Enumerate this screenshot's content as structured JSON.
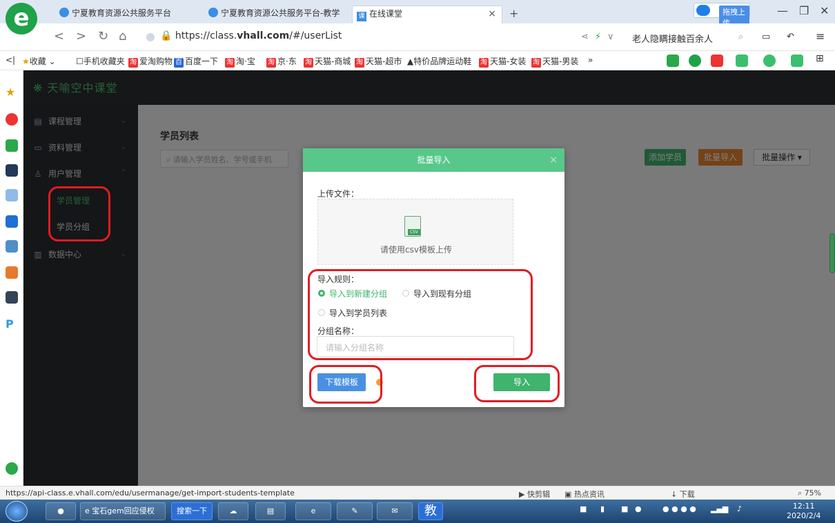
{
  "browser": {
    "tabs": [
      {
        "label": "宁夏教育资源公共服务平台"
      },
      {
        "label": "宁夏教育资源公共服务平台-教学"
      },
      {
        "label": "在线课堂"
      }
    ],
    "new_tab": "+",
    "upload_chip": "拖拽上传",
    "url_prefix": "https://class.",
    "url_host": "vhall.com",
    "url_suffix": "/#/userList",
    "news_text": "老人隐瞒接触百余人",
    "bookmarks": [
      {
        "label": "收藏",
        "tb": ""
      },
      {
        "label": "手机收藏夹",
        "tb": ""
      },
      {
        "label": "爱淘购物",
        "tb": "淘"
      },
      {
        "label": "百度一下",
        "tb": ""
      },
      {
        "label": "淘·宝",
        "tb": "淘"
      },
      {
        "label": "京·东",
        "tb": "淘"
      },
      {
        "label": "天猫-商城",
        "tb": "淘"
      },
      {
        "label": "天猫-超市",
        "tb": "淘"
      },
      {
        "label": "特价品牌运动鞋",
        "tb": ""
      },
      {
        "label": "天猫-女装",
        "tb": "淘"
      },
      {
        "label": "天猫-男装",
        "tb": "淘"
      },
      {
        "label": "»",
        "tb": ""
      }
    ],
    "status_url": "https://api-class.e.vhall.com/edu/usermanage/get-import-students-template",
    "status_right": {
      "quick_clip": "快剪辑",
      "hot_news": "热点资讯",
      "download": "下载",
      "zoom": "75%"
    }
  },
  "app": {
    "logo": "天喻空中课堂",
    "menu": [
      {
        "label": "课程管理",
        "icon": "course-icon"
      },
      {
        "label": "资料管理",
        "icon": "folder-icon"
      },
      {
        "label": "用户管理",
        "icon": "users-icon"
      },
      {
        "label": "数据中心",
        "icon": "chart-icon"
      }
    ],
    "submenu": [
      {
        "label": "学员管理"
      },
      {
        "label": "学员分组"
      }
    ],
    "page_title": "学员列表",
    "search_placeholder": "请输入学员姓名、学号或手机",
    "add_student": "添加学员",
    "batch_import": "批量导入",
    "batch_ops": "批量操作 ▾"
  },
  "modal": {
    "title": "批量导入",
    "upload_label": "上传文件：",
    "upload_hint": "请使用csv模板上传",
    "csv_tag": "CSV",
    "rules_label": "导入规则：",
    "rules": [
      {
        "label": "导入到新建分组",
        "selected": true
      },
      {
        "label": "导入到现有分组",
        "selected": false
      },
      {
        "label": "导入到学员列表",
        "selected": false
      }
    ],
    "group_name_label": "分组名称：",
    "group_name_placeholder": "请输入分组名称",
    "download_template": "下载模板",
    "import": "导入"
  },
  "taskbar": {
    "items": [
      {
        "label": "宝石gem回应侵权"
      },
      {
        "label": "搜索一下"
      }
    ],
    "edu_label": "教",
    "time": "12:11",
    "date": "2020/2/4"
  }
}
